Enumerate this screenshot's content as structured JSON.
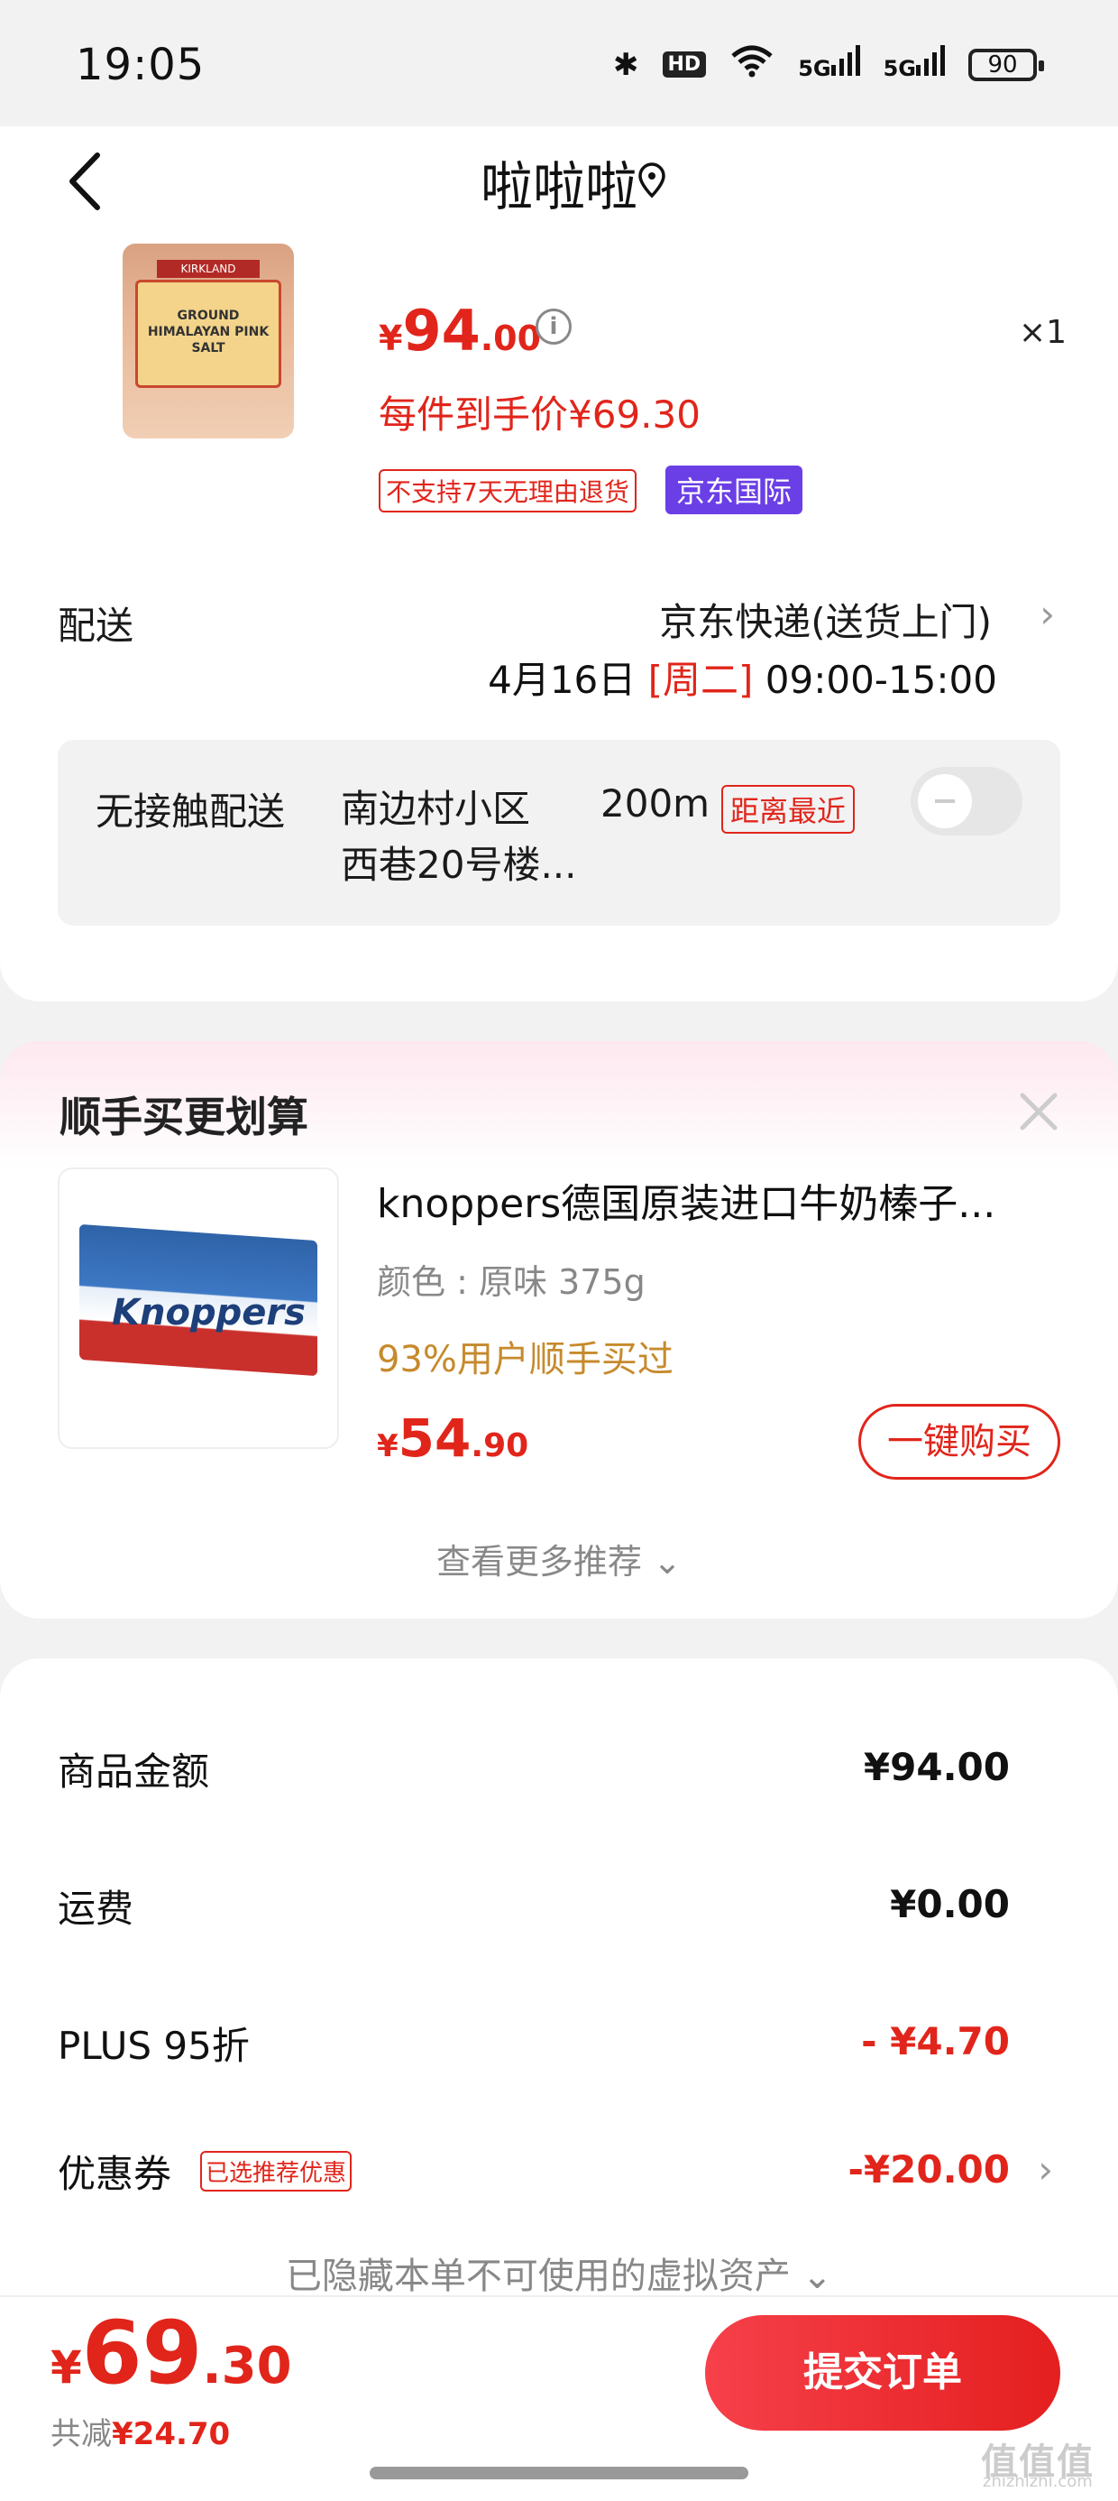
{
  "status_bar": {
    "time": "19:05",
    "hd": "HD",
    "sig1": "5G",
    "sig2": "5G",
    "battery": "90"
  },
  "header": {
    "title": "啦啦啦"
  },
  "product": {
    "image_brand": "KIRKLAND",
    "image_text": "GROUND HIMALAYAN PINK SALT",
    "price_symbol": "¥",
    "price_int": "94",
    "price_dec": ".00",
    "quantity": "×1",
    "unit_price": "每件到手价¥69.30",
    "tag_no_return": "不支持7天无理由退货",
    "tag_intl": "京东国际"
  },
  "delivery": {
    "label": "配送",
    "method": "京东快递(送货上门)",
    "date": "4月16日",
    "weekday": "[周二]",
    "time": "09:00-15:00"
  },
  "contactless": {
    "label": "无接触配送",
    "address_line1": "南边村小区",
    "address_line2": "西巷20号楼...",
    "distance": "200m",
    "tag": "距离最近"
  },
  "recommend": {
    "title": "顺手买更划算",
    "product_name": "knoppers德国原装进口牛奶榛子...",
    "image_text": "Knoppers",
    "spec": "颜色 : 原味 375g",
    "percent": "93%用户顺手买过",
    "price_symbol": "¥",
    "price_int": "54",
    "price_dec": ".90",
    "buy_label": "一键购买",
    "more_label": "查看更多推荐"
  },
  "summary": {
    "goods_label": "商品金额",
    "goods_value": "¥94.00",
    "shipping_label": "运费",
    "shipping_value": "¥0.00",
    "plus_label": "PLUS 95折",
    "plus_value": "- ¥4.70",
    "coupon_label": "优惠券",
    "coupon_tag": "已选推荐优惠",
    "coupon_value": "-¥20.00",
    "hidden_assets": "已隐藏本单不可使用的虚拟资产"
  },
  "bottom": {
    "total_symbol": "¥",
    "total_int": "69",
    "total_dec": ".30",
    "saved_label": "共减",
    "saved_value": "¥24.70",
    "submit_label": "提交订单"
  },
  "watermark": {
    "main": "值值值",
    "sub": "zhizhizhi.com"
  },
  "colors": {
    "accent": "#e1251b",
    "intl_tag": "#6b3fe6",
    "gold": "#c68a2c"
  }
}
